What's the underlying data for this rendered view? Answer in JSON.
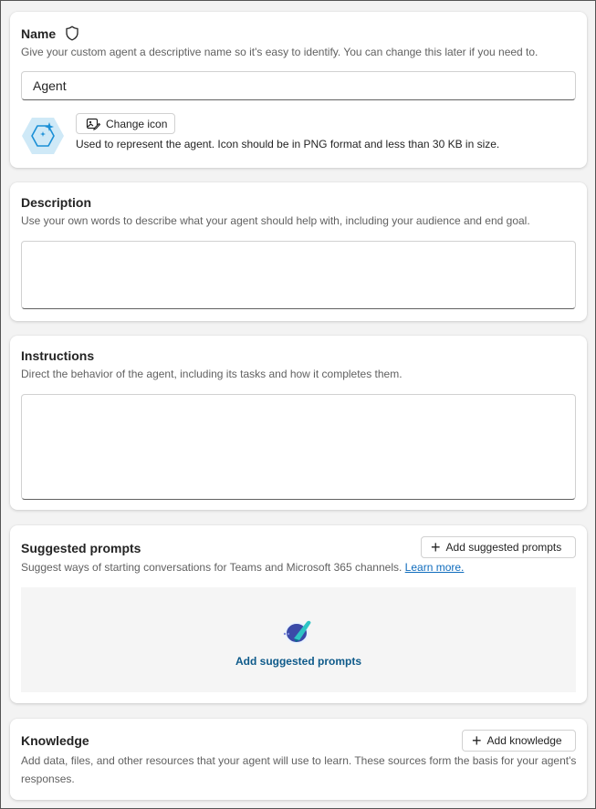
{
  "name_section": {
    "title": "Name",
    "description": "Give your custom agent a descriptive name so it's easy to identify. You can change this later if you need to.",
    "input_value": "Agent",
    "change_icon_label": "Change icon",
    "icon_hint": "Used to represent the agent. Icon should be in PNG format and less than 30 KB in size."
  },
  "description_section": {
    "title": "Description",
    "description": "Use your own words to describe what your agent should help with, including your audience and end goal.",
    "input_value": ""
  },
  "instructions_section": {
    "title": "Instructions",
    "description": "Direct the behavior of the agent, including its tasks and how it completes them.",
    "input_value": ""
  },
  "suggested_prompts_section": {
    "title": "Suggested prompts",
    "add_button_label": "Add suggested prompts",
    "description": "Suggest ways of starting conversations for Teams and Microsoft 365 channels.",
    "learn_more": "Learn more.",
    "empty_state_link": "Add suggested prompts"
  },
  "knowledge_section": {
    "title": "Knowledge",
    "add_button_label": "Add knowledge",
    "description": "Add data, files, and other resources that your agent will use to learn. These sources form the basis for your agent's responses."
  },
  "colors": {
    "accent_link": "#0f6cbd",
    "empty_state_link": "#0e5a8a",
    "agent_icon_bg": "#cfe9f7",
    "agent_icon_stroke": "#1a8fd6"
  }
}
